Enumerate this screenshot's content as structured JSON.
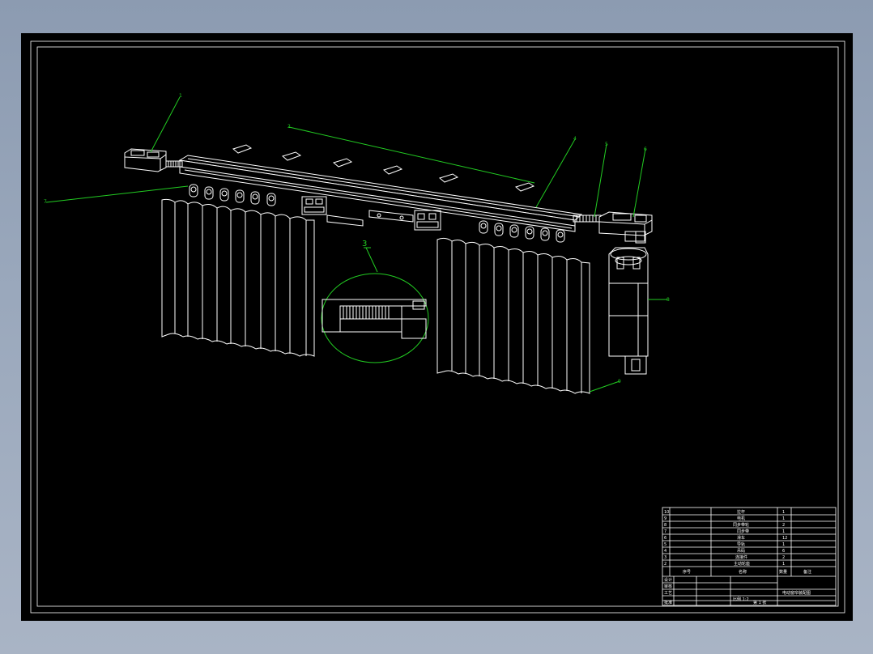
{
  "drawing": {
    "callouts": [
      "1",
      "2",
      "3",
      "4",
      "5",
      "6",
      "7",
      "8",
      "9",
      "10"
    ],
    "detail_label": "3"
  },
  "title_block": {
    "parts_rows": [
      {
        "no": "10",
        "name": "拉杆",
        "qty": "1"
      },
      {
        "no": "9",
        "name": "电机",
        "qty": "1"
      },
      {
        "no": "8",
        "name": "同步带轮",
        "qty": "2"
      },
      {
        "no": "7",
        "name": "同步带",
        "qty": "1"
      },
      {
        "no": "6",
        "name": "滑车",
        "qty": "12"
      },
      {
        "no": "5",
        "name": "导轨",
        "qty": "1"
      },
      {
        "no": "4",
        "name": "吊码",
        "qty": "6"
      },
      {
        "no": "3",
        "name": "连接件",
        "qty": "2"
      },
      {
        "no": "2",
        "name": "主动轮座",
        "qty": "1"
      },
      {
        "no": "1",
        "name": "从动轮座",
        "qty": "1"
      }
    ],
    "header": {
      "col1": "序号",
      "col2": "名称",
      "col3": "数量",
      "col4": "备注"
    },
    "drawing_title": "电动窗帘装配图",
    "left_labels": [
      "设计",
      "审核",
      "工艺",
      "批准"
    ],
    "scale_row": "比例 1:2",
    "sheet_row": "第 1 张"
  }
}
